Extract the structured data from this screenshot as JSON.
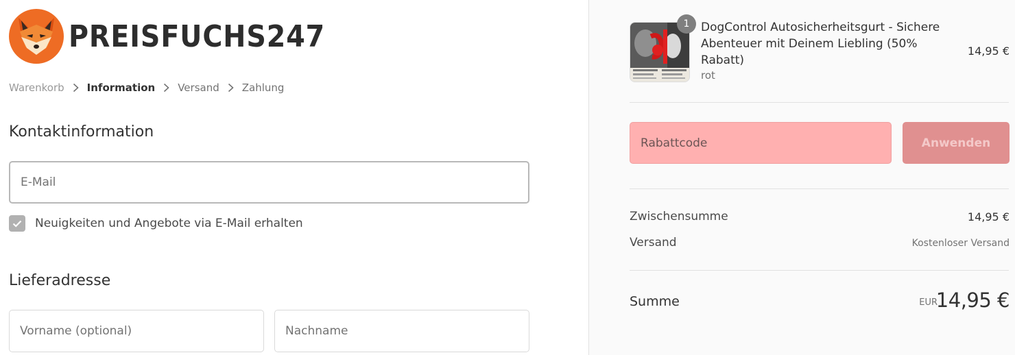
{
  "brand": {
    "name": "PREISFUCHS247",
    "logo": "fox-logo",
    "accent": "#ee6c24"
  },
  "breadcrumb": [
    {
      "label": "Warenkorb",
      "state": "done"
    },
    {
      "label": "Information",
      "state": "current"
    },
    {
      "label": "Versand",
      "state": "upcoming"
    },
    {
      "label": "Zahlung",
      "state": "upcoming"
    }
  ],
  "contact": {
    "title": "Kontaktinformation",
    "email_placeholder": "E-Mail",
    "newsletter_label": "Neuigkeiten und Angebote via E-Mail erhalten",
    "newsletter_checked": true
  },
  "shipping_address": {
    "title": "Lieferadresse",
    "first_name_placeholder": "Vorname (optional)",
    "last_name_placeholder": "Nachname"
  },
  "order_summary": {
    "item": {
      "quantity": "1",
      "name": "DogControl Autosicherheitsgurt - Sichere Abenteuer mit Deinem Liebling (50% Rabatt)",
      "variant": "rot",
      "price": "14,95 €"
    },
    "discount": {
      "placeholder": "Rabattcode",
      "apply_label": "Anwenden"
    },
    "subtotal_label": "Zwischensumme",
    "subtotal_value": "14,95 €",
    "shipping_label": "Versand",
    "shipping_value": "Kostenloser Versand",
    "total_label": "Summe",
    "total_currency": "EUR",
    "total_value": "14,95 €"
  },
  "colors": {
    "discount_bg": "#ffb0b0",
    "apply_bg": "#e09090",
    "badge": "#7f7f7f"
  }
}
